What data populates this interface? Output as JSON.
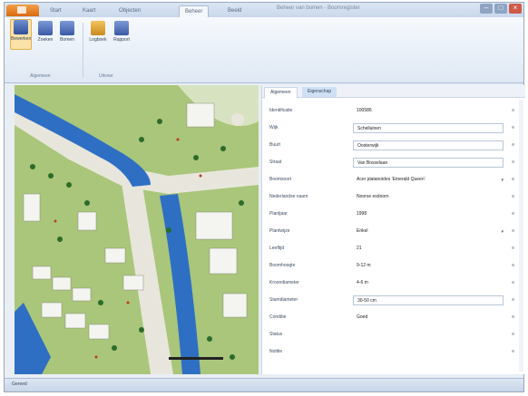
{
  "titlebar": {
    "title": "Beheer van bomen - Boomregister",
    "tabs": [
      "Start",
      "Kaart",
      "Objecten",
      "Beheer",
      "Beeld"
    ],
    "active_tab_index": 3
  },
  "ribbon": {
    "buttons": [
      {
        "label": "Bewerken",
        "icon": "edit-icon",
        "selected": true
      },
      {
        "label": "Zoeken",
        "icon": "search-icon"
      },
      {
        "label": "Bomen",
        "icon": "tree-icon"
      },
      {
        "label": "Logboek",
        "icon": "book-icon"
      },
      {
        "label": "Rapport",
        "icon": "report-icon"
      }
    ],
    "groups": [
      "Algemeen",
      "Uitvoer"
    ]
  },
  "panel": {
    "tabs": [
      "Algemeen",
      "Eigenschap"
    ],
    "active_tab_index": 0,
    "fields": [
      {
        "label": "Identificatie",
        "value": "100586",
        "boxed": false
      },
      {
        "label": "Wijk",
        "value": "Schelluinen",
        "boxed": true
      },
      {
        "label": "Buurt",
        "value": "Oosterwijk",
        "boxed": true
      },
      {
        "label": "Straat",
        "value": "Van Bosselaan",
        "boxed": true
      },
      {
        "label": "Boomsoort",
        "value": "Acer platanoides 'Emerald Queen'",
        "boxed": false,
        "dropdown": true
      },
      {
        "label": "Nederlandse naam",
        "value": "Noorse esdoorn",
        "boxed": false
      },
      {
        "label": "Plantjaar",
        "value": "1998",
        "boxed": false
      },
      {
        "label": "Plantwijze",
        "value": "Enkel",
        "boxed": false,
        "dropdown": true
      },
      {
        "label": "Leeftijd",
        "value": "21",
        "boxed": false
      },
      {
        "label": "Boomhoogte",
        "value": "9-12 m",
        "boxed": false
      },
      {
        "label": "Kroondiameter",
        "value": "4-6 m",
        "boxed": false
      },
      {
        "label": "Stamdiameter",
        "value": "30-50 cm",
        "boxed": true
      },
      {
        "label": "Conditie",
        "value": "Goed",
        "boxed": false
      },
      {
        "label": "Status",
        "value": "",
        "boxed": false
      },
      {
        "label": "Notitie",
        "value": "",
        "boxed": false
      }
    ]
  },
  "statusbar": {
    "text": "Gereed"
  },
  "colors": {
    "map_green": "#a9c67a",
    "water_blue": "#2e6fc4",
    "road": "#f2f2ee",
    "ribbon_accent": "#d96a10"
  }
}
